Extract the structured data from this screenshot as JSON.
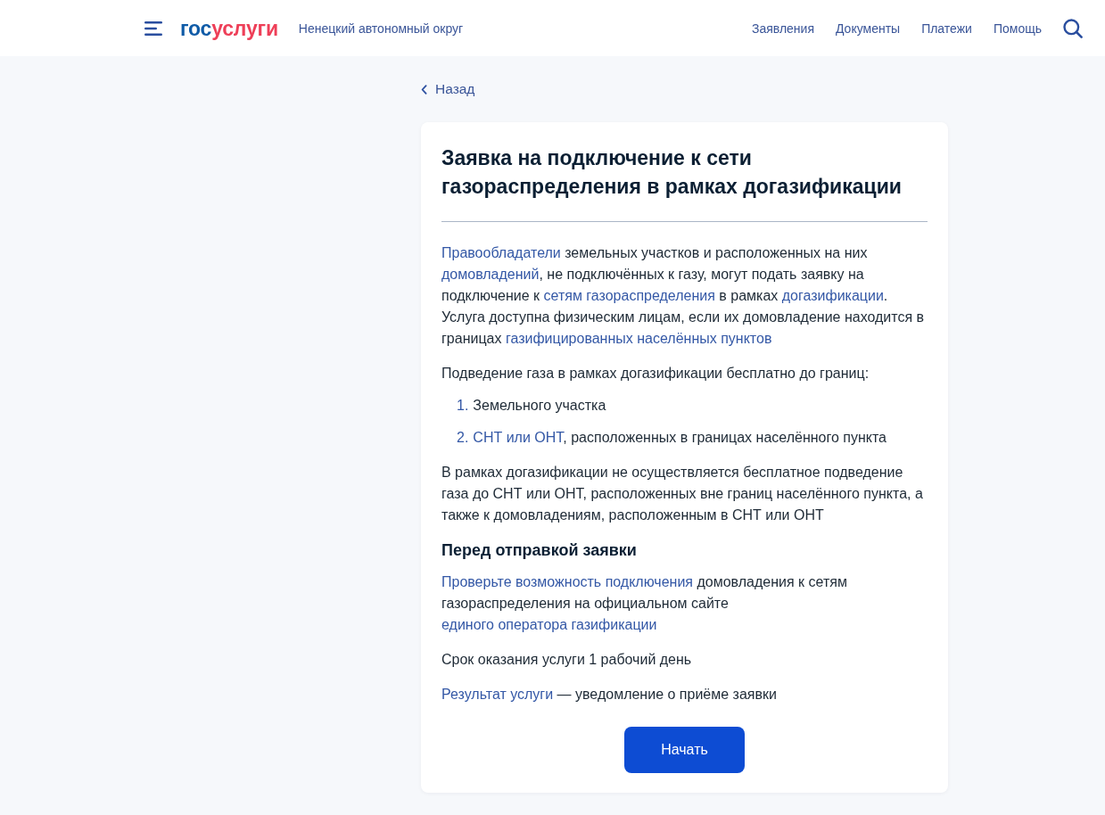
{
  "header": {
    "logo": {
      "prefix": "гос",
      "suffix": "услуги"
    },
    "region": "Ненецкий автономный округ",
    "nav": [
      "Заявления",
      "Документы",
      "Платежи",
      "Помощь"
    ]
  },
  "back_link": "Назад",
  "card": {
    "title": "Заявка на подключение к сети газораспределения в рамках догазификации",
    "blocks": [
      {
        "kind": "paragraph",
        "segments": [
          {
            "kind": "link",
            "text": "Правообладатели"
          },
          {
            "kind": "text",
            "text": " земельных участков и расположенных на них "
          },
          {
            "kind": "link",
            "text": "домовладений"
          },
          {
            "kind": "text",
            "text": ", не подключённых к газу, могут подать заявку на подключение к "
          },
          {
            "kind": "link",
            "text": "сетям газораспределения"
          },
          {
            "kind": "text",
            "text": " в рамках "
          },
          {
            "kind": "link",
            "text": "догазификации"
          },
          {
            "kind": "text",
            "text": ". Услуга доступна физическим лицам, если их домовладение находится в границах "
          },
          {
            "kind": "link",
            "text": "газифицированных населённых пунктов"
          }
        ]
      },
      {
        "kind": "paragraph",
        "segments": [
          {
            "kind": "text",
            "text": "Подведение газа в рамках догазификации бесплатно до границ:"
          }
        ]
      },
      {
        "kind": "list",
        "items": [
          {
            "number": "1.",
            "segments": [
              {
                "kind": "text",
                "text": "Земельного участка"
              }
            ]
          },
          {
            "number": "2.",
            "segments": [
              {
                "kind": "link",
                "text": "СНТ или ОНТ"
              },
              {
                "kind": "text",
                "text": ", расположенных в границах населённого пункта"
              }
            ]
          }
        ]
      },
      {
        "kind": "paragraph",
        "segments": [
          {
            "kind": "text",
            "text": "В рамках догазификации не осуществляется бесплатное подведение газа до СНТ или ОНТ, расположенных вне границ населённого пункта, а также к домовладениям, расположенным в СНТ или ОНТ"
          }
        ]
      },
      {
        "kind": "heading",
        "text": "Перед отправкой заявки"
      },
      {
        "kind": "paragraph",
        "segments": [
          {
            "kind": "link",
            "text": "Проверьте возможность подключения"
          },
          {
            "kind": "text",
            "text": " домовладения к сетям газораспределения на официальном сайте "
          },
          {
            "kind": "link",
            "text": "единого оператора газификации"
          }
        ]
      },
      {
        "kind": "paragraph",
        "segments": [
          {
            "kind": "text",
            "text": "Срок оказания услуги 1 рабочий день"
          }
        ]
      },
      {
        "kind": "paragraph",
        "segments": [
          {
            "kind": "link",
            "text": "Результат услуги"
          },
          {
            "kind": "text",
            "text": " — уведомление о приёме заявки"
          }
        ]
      }
    ],
    "button": "Начать"
  }
}
